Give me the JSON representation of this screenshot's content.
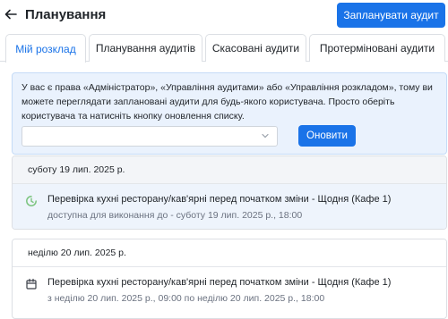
{
  "header": {
    "title": "Планування",
    "schedule_button": "Запланувати аудит"
  },
  "tabs": [
    {
      "label": "Мій розклад",
      "active": true
    },
    {
      "label": "Планування аудитів",
      "active": false
    },
    {
      "label": "Скасовані аудити",
      "active": false
    },
    {
      "label": "Протерміновані аудити",
      "active": false
    }
  ],
  "info": {
    "message": "У вас є права «Адміністратор», «Управління аудитами» або «Управління розкладом», тому ви можете переглядати заплановані аудити для будь-якого користувача. Просто оберіть користувача та натисніть кнопку оновлення списку.",
    "user_select_value": "",
    "refresh_button": "Оновити"
  },
  "days": [
    {
      "date": "суботу 19 лип. 2025 р.",
      "items": [
        {
          "icon": "clock-icon",
          "title": "Перевірка кухні ресторану/кав'ярні перед початком зміни - Щодня (Кафе 1)",
          "subtitle": "доступна для виконання до - суботу 19 лип. 2025 р., 18:00"
        }
      ]
    },
    {
      "date": "неділю 20 лип. 2025 р.",
      "items": [
        {
          "icon": "calendar-icon",
          "title": "Перевірка кухні ресторану/кав'ярні перед початком зміни - Щодня (Кафе 1)",
          "subtitle": "з неділю 20 лип. 2025 р., 09:00 по неділю 20 лип. 2025 р., 18:00"
        }
      ]
    }
  ],
  "colors": {
    "primary": "#1a73e8",
    "info_bg": "#eaf2fd",
    "clock_icon": "#7cc47f"
  }
}
